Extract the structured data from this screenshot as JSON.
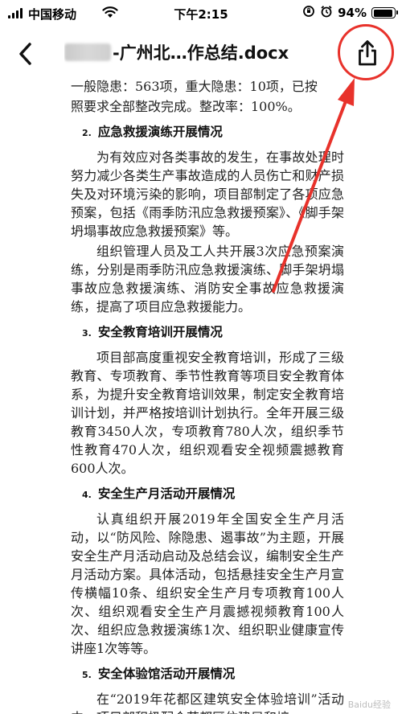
{
  "status_bar": {
    "carrier": "中国移动",
    "time": "下午2:15",
    "battery": "94%",
    "battery_level": 0.94
  },
  "nav": {
    "title_visible": "-广州北…作总结.docx",
    "back_icon": "chevron-left-icon",
    "share_icon": "share-icon",
    "highlight_color": "#e8322b"
  },
  "document": {
    "top_line": "一般隐患：563项，重大隐患：10项，已按",
    "p0": "照要求全部整改完成。整改率：100%。",
    "sections": [
      {
        "num": "2.",
        "title": "应急救援演练开展情况"
      },
      {
        "num": "3.",
        "title": "安全教育培训开展情况"
      },
      {
        "num": "4.",
        "title": "安全生产月活动开展情况"
      },
      {
        "num": "5.",
        "title": "安全体验馆活动开展情况"
      }
    ],
    "p1": "为有效应对各类事故的发生，在事故处理时努力减少各类生产事故造成的人员伤亡和财产损失及对环境污染的影响，项目部制定了各项应急预案，包括《雨季防汛应急救援预案》、《脚手架坍塌事故应急救援预案》等。",
    "p2": "组织管理人员及工人共开展3次应急预案演练，分别是雨季防汛应急救援演练、脚手架坍塌事故应急救援演练、消防安全事故应急救援演练，提高了项目应急救援能力。",
    "p3": "项目部高度重视安全教育培训，形成了三级教育、专项教育、季节性教育等项目安全教育体系，为提升安全教育培训效果，制定安全教育培训计划，并严格按培训计划执行。全年开展三级教育3450人次，专项教育780人次，组织季节性教育470人次，组织观看安全视频震撼教育600人次。",
    "p4": "认真组织开展2019年全国安全生产月活动，以“防风险、除隐患、遏事故”为主题，开展安全生产月活动启动及总结会议，编制安全生产月活动方案。具体活动，包括悬挂安全生产月宣传横幅10条、组织安全生产月专项教育100人次、组织观看安全生产月震撼视频教育100人次、组织应急救援演练1次、组织职业健康宣传讲座1次等等。",
    "p5": "在“2019年花都区建筑安全体验培训”活动中，项目部积极配合花都区住建局和培"
  },
  "watermark": "Baidu经验"
}
